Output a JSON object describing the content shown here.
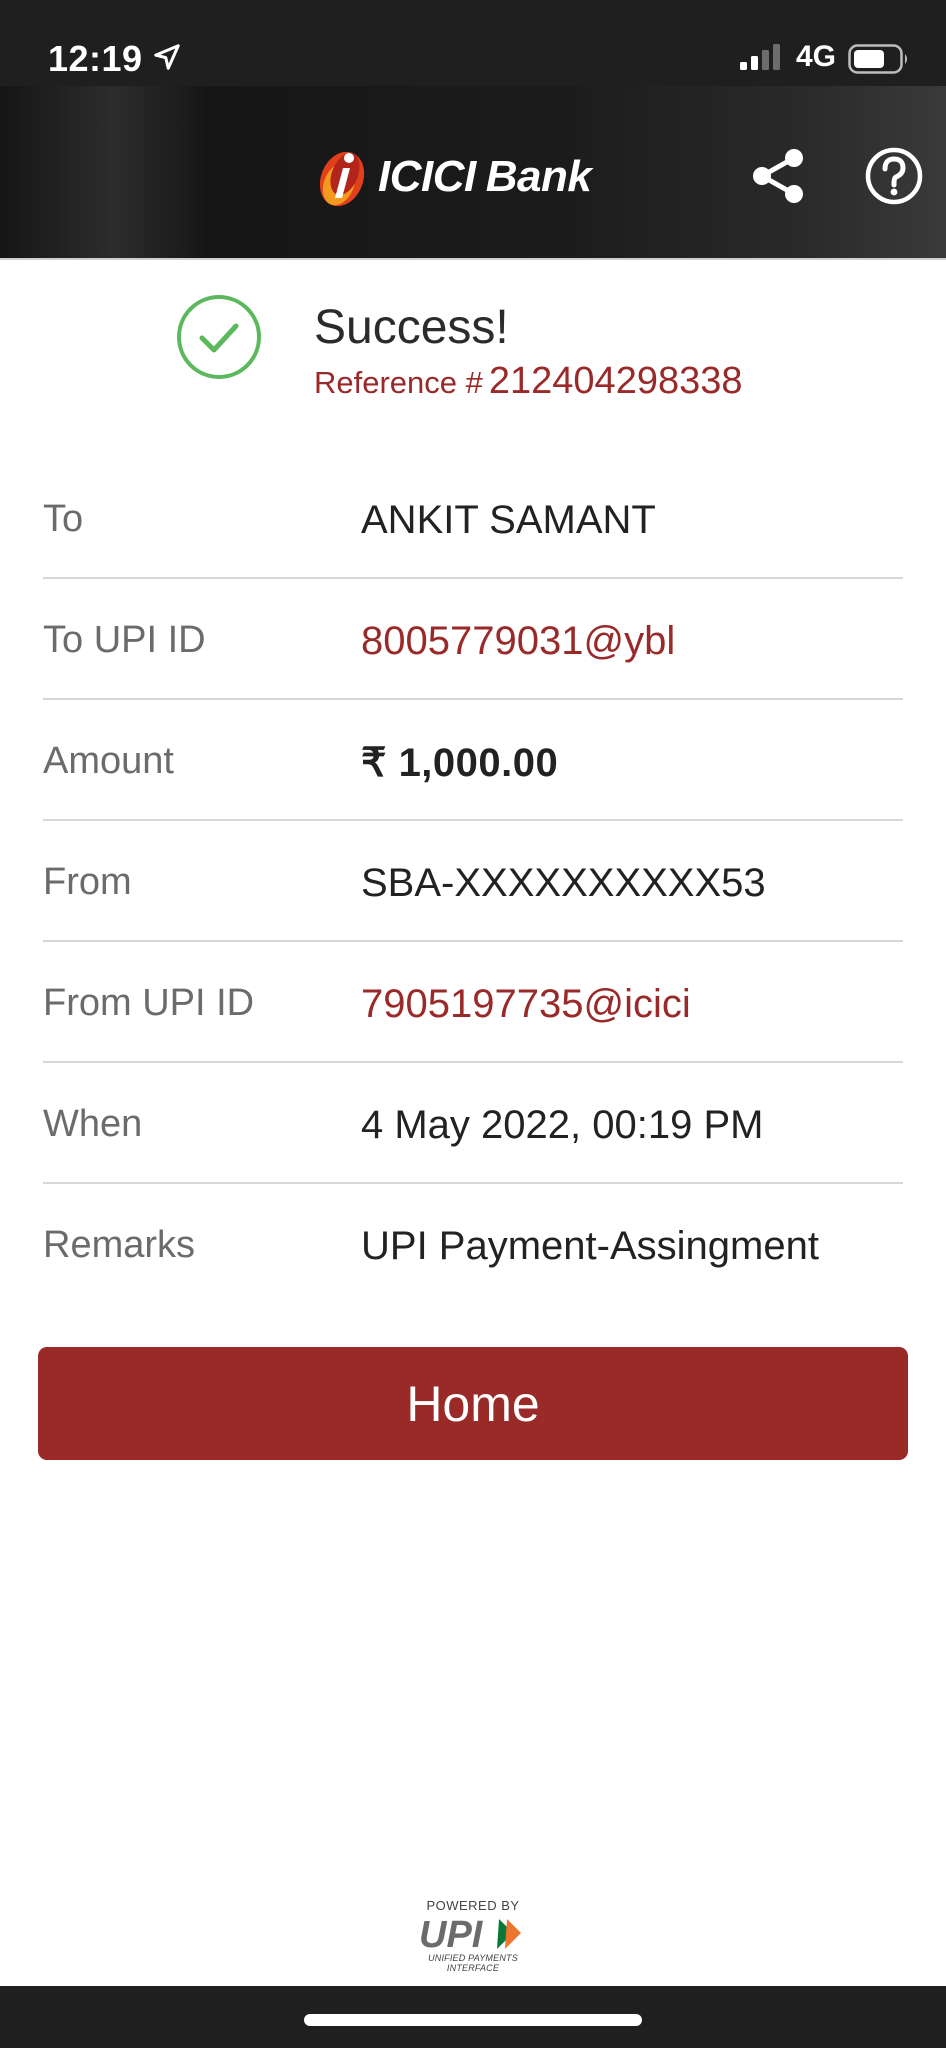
{
  "status_bar": {
    "time": "12:19",
    "network": "4G",
    "icons": [
      "location-arrow-icon",
      "signal-icon",
      "battery-icon"
    ]
  },
  "header": {
    "logo_name": "ICICI",
    "logo_suffix": "Bank",
    "icons": [
      "share-icon",
      "help-icon"
    ]
  },
  "success": {
    "title": "Success!",
    "reference_label": "Reference #",
    "reference_number": "212404298338",
    "icon": "check-circle-icon",
    "accent_color": "#5cb85c"
  },
  "details": [
    {
      "label": "To",
      "value": "ANKIT SAMANT"
    },
    {
      "label": "To UPI ID",
      "value": "8005779031@ybl"
    },
    {
      "label": "Amount",
      "value": "₹ 1,000.00"
    },
    {
      "label": "From",
      "value": "SBA-XXXXXXXXXX53"
    },
    {
      "label": "From UPI ID",
      "value": "7905197735@icici"
    },
    {
      "label": "When",
      "value": "4 May 2022, 00:19 PM"
    },
    {
      "label": "Remarks",
      "value": "UPI Payment-Assingment"
    }
  ],
  "home_button": {
    "label": "Home"
  },
  "footer": {
    "powered_by": "POWERED BY",
    "upi_name": "UPI",
    "upi_full": "UNIFIED PAYMENTS INTERFACE"
  },
  "colors": {
    "brand_red": "#992a28",
    "link_red": "#9a2a2a",
    "header_dark": "#1c1c1d"
  }
}
